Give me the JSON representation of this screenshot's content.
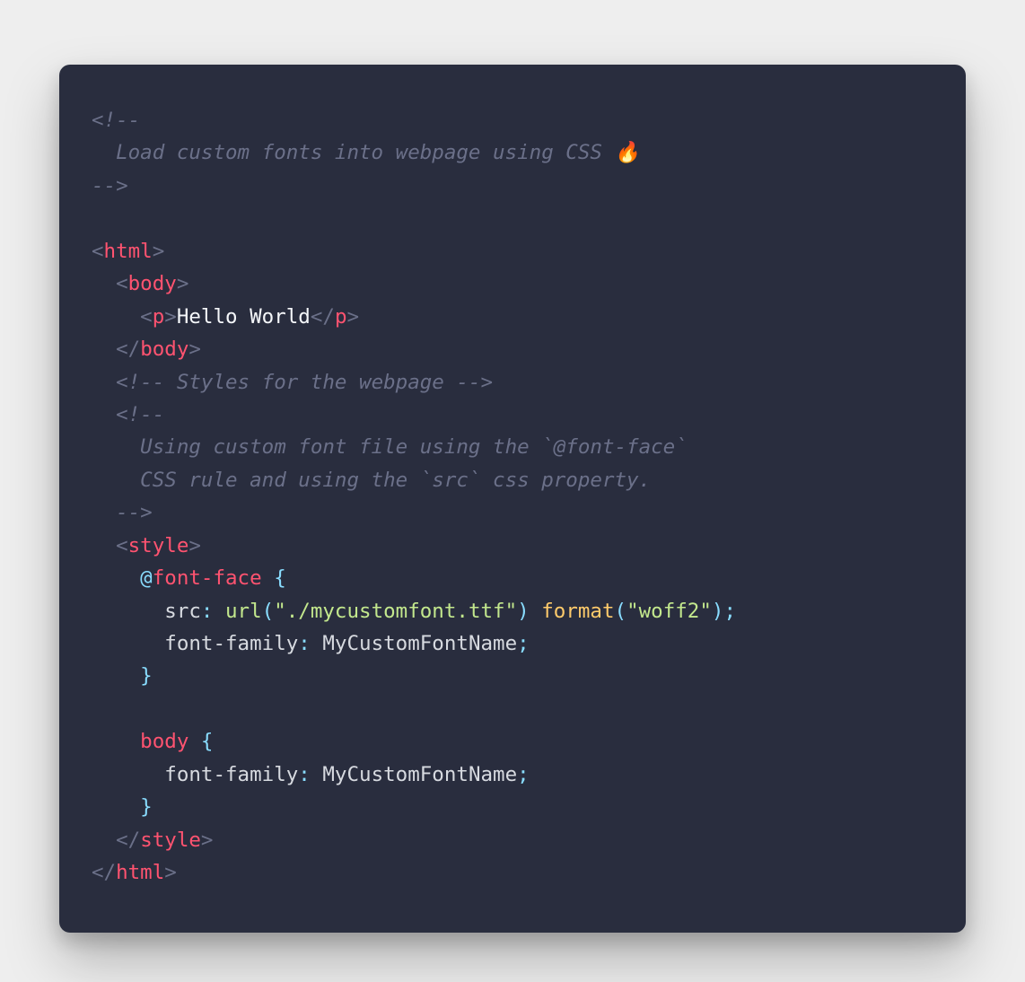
{
  "colors": {
    "background_page": "#eeeeee",
    "background_card": "#292d3e",
    "comment": "#6b7089",
    "punctuation": "#89ddff",
    "tag": "#ff5370",
    "text": "#f5f7fa",
    "string": "#c3e88d",
    "format_func": "#ffcb6b"
  },
  "code": {
    "comment1_open": "<!--",
    "comment1_line": "  Load custom fonts into webpage using CSS 🔥",
    "comment1_close": "-->",
    "html_open_lt": "<",
    "html_tag": "html",
    "gt": ">",
    "body_open_lt": "  <",
    "body_tag": "body",
    "p_open_lt": "    <",
    "p_tag": "p",
    "p_text": "Hello World",
    "p_close_lt": "</",
    "body_close_lt": "  </",
    "comment2_open": "  <!-- ",
    "comment2_text": "Styles for the webpage",
    "comment2_close": " -->",
    "comment3_open": "  <!--",
    "comment3_line1": "    Using custom font file using the `@font-face`",
    "comment3_line2": "    CSS rule and using the `src` css property.",
    "comment3_close": "  -->",
    "style_open_lt": "  <",
    "style_tag": "style",
    "at_symbol": "    @",
    "at_name": "font-face",
    "brace_open": " {",
    "src_prop": "      src",
    "colon": ": ",
    "url_func": "url",
    "paren_open": "(",
    "url_str": "\"./mycustomfont.ttf\"",
    "paren_close": ")",
    "space": " ",
    "format_func": "format",
    "format_str": "\"woff2\"",
    "semicolon": ";",
    "ff_prop": "      font-family",
    "ff_value": "MyCustomFontName",
    "brace_close": "    }",
    "body_sel": "    body",
    "ff_prop2": "      font-family",
    "style_close_lt": "  </",
    "html_close_lt": "</"
  }
}
